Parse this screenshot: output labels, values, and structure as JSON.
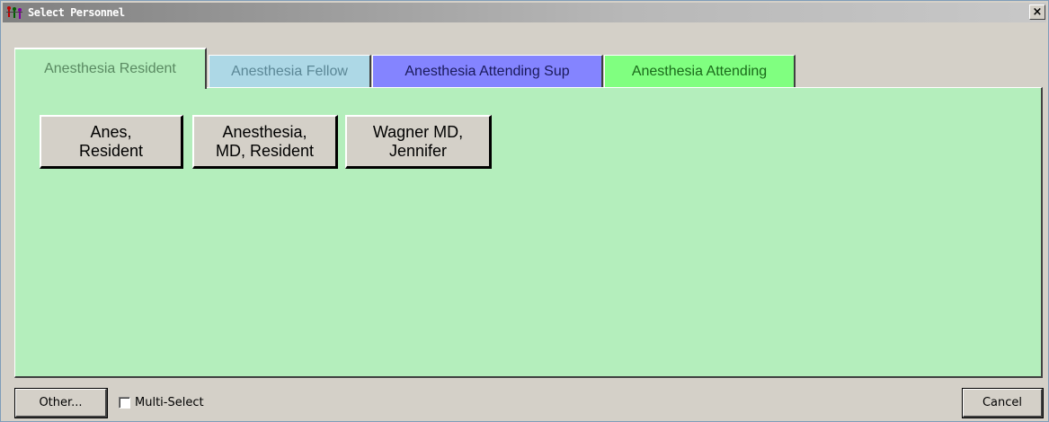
{
  "window": {
    "title": "Select Personnel",
    "icon": "personnel-app-icon",
    "close_label": "×"
  },
  "tabs": [
    {
      "label": "Anesthesia Resident",
      "bg": "#b4eebc",
      "fg": "#5a8a62",
      "active": true
    },
    {
      "label": "Anesthesia Fellow",
      "bg": "#add8e6",
      "fg": "#5b8796",
      "active": false
    },
    {
      "label": "Anesthesia Attending Sup",
      "bg": "#8484ff",
      "fg": "#1a1a5a",
      "active": false
    },
    {
      "label": "Anesthesia Attending",
      "bg": "#80ff80",
      "fg": "#1a6a1a",
      "active": false
    }
  ],
  "panel": {
    "bg": "#b4eebc",
    "personnel": [
      {
        "label": "Anes,\nResident"
      },
      {
        "label": "Anesthesia,\nMD, Resident"
      },
      {
        "label": "Wagner  MD,\nJennifer"
      }
    ]
  },
  "footer": {
    "other_label": "Other...",
    "multi_select_label": "Multi-Select",
    "multi_select_checked": false,
    "cancel_label": "Cancel"
  }
}
